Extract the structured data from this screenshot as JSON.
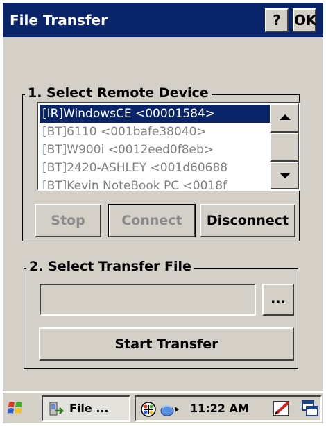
{
  "window": {
    "title": "File Transfer",
    "help_label": "?",
    "ok_label": "OK"
  },
  "remote_device": {
    "group_label": "1. Select Remote Device",
    "devices": [
      "[IR]WindowsCE <00001584>",
      "[BT]6110 <001bafe38040>",
      "[BT]W900i <0012eed0f8eb>",
      "[BT]2420-ASHLEY <001d60688",
      "[BT]Kevin NoteBook PC <0018f"
    ],
    "selected_index": 0,
    "buttons": {
      "stop": "Stop",
      "connect": "Connect",
      "disconnect": "Disconnect"
    }
  },
  "transfer_file": {
    "group_label": "2. Select Transfer File",
    "file_path": "",
    "browse_label": "...",
    "start_label": "Start Transfer"
  },
  "taskbar": {
    "task_label": "File ...",
    "clock": "11:22 AM"
  },
  "colors": {
    "titlebar": "#0a246a",
    "selection": "#0a246a",
    "window_bg": "#d4d0c8",
    "disabled_text": "#8a8a8a"
  }
}
